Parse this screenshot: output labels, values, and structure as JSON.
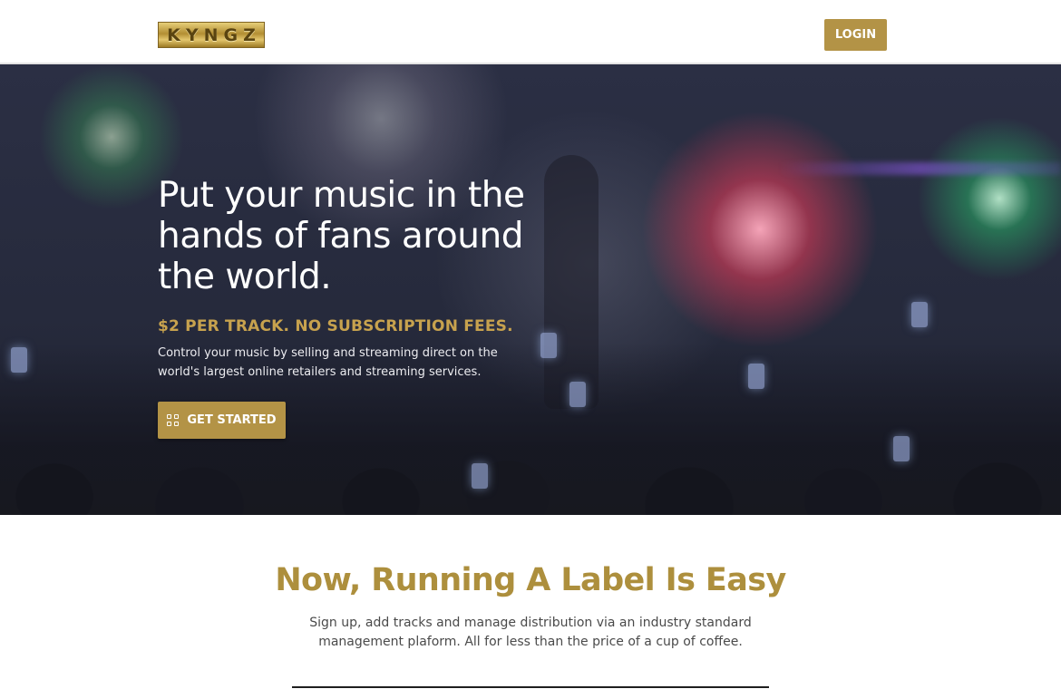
{
  "header": {
    "logo_text": "KYNGZ",
    "login_label": "LOGIN"
  },
  "hero": {
    "title": "Put your music in the hands of fans around the world.",
    "subtitle": "$2 PER TRACK. NO SUBSCRIPTION FEES.",
    "description": "Control your music by selling and streaming direct on the world's largest online retailers and streaming services.",
    "cta_label": "GET STARTED",
    "cta_icon": "grid-icon"
  },
  "section": {
    "title": "Now, Running A Label Is Easy",
    "text": "Sign up, add tracks and manage distribution via an industry standard management plaform. All for less than the price of a cup of coffee."
  },
  "colors": {
    "accent": "#b39346",
    "heading_gold": "#ad8f3d",
    "subtitle_gold": "#c7a24e"
  }
}
